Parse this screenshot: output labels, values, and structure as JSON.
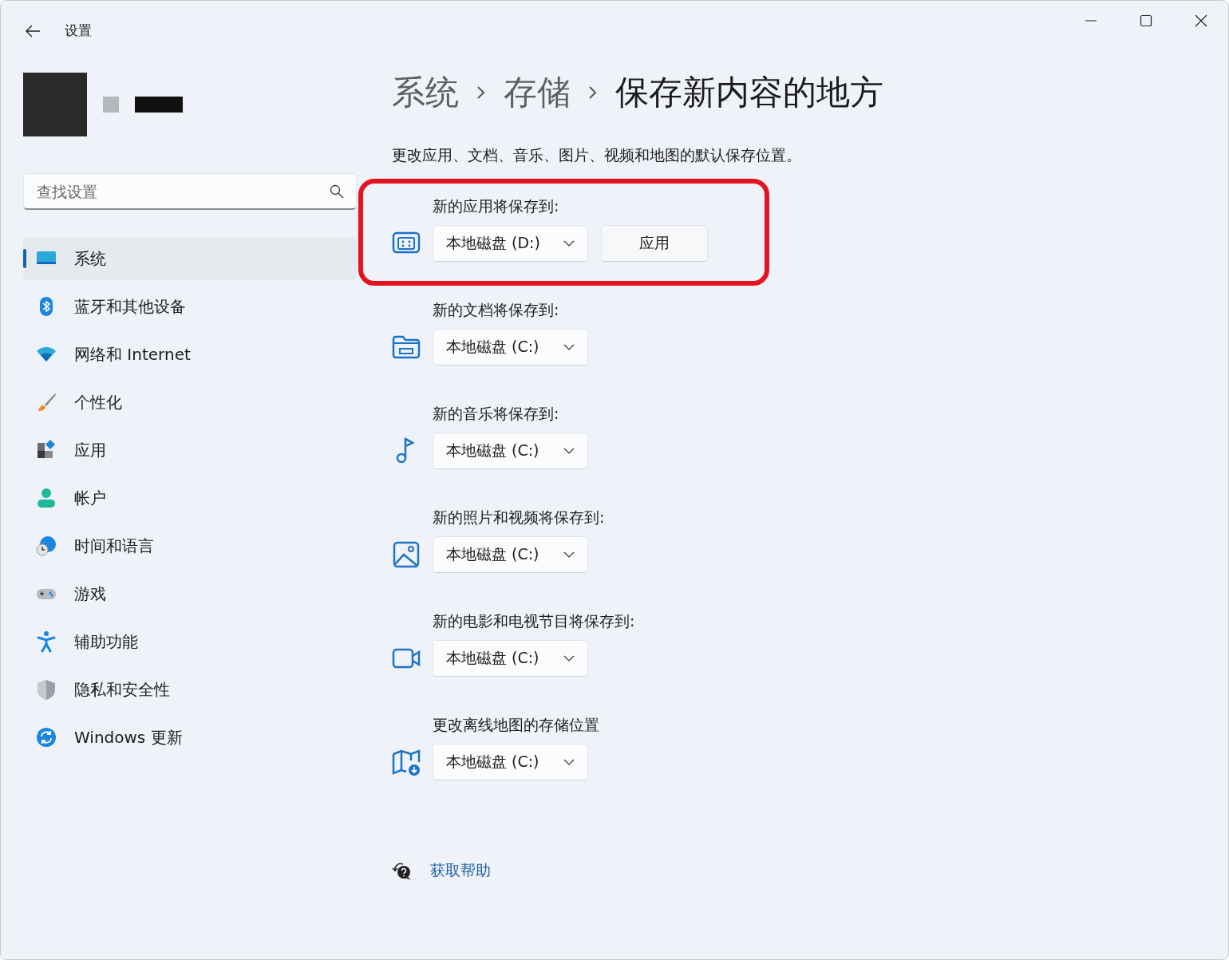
{
  "window": {
    "title": "设置"
  },
  "search": {
    "placeholder": "查找设置"
  },
  "sidebar": {
    "items": [
      {
        "label": "系统",
        "selected": true
      },
      {
        "label": "蓝牙和其他设备",
        "selected": false
      },
      {
        "label": "网络和 Internet",
        "selected": false
      },
      {
        "label": "个性化",
        "selected": false
      },
      {
        "label": "应用",
        "selected": false
      },
      {
        "label": "帐户",
        "selected": false
      },
      {
        "label": "时间和语言",
        "selected": false
      },
      {
        "label": "游戏",
        "selected": false
      },
      {
        "label": "辅助功能",
        "selected": false
      },
      {
        "label": "隐私和安全性",
        "selected": false
      },
      {
        "label": "Windows 更新",
        "selected": false
      }
    ]
  },
  "breadcrumb": [
    "系统",
    "存储",
    "保存新内容的地方"
  ],
  "description": "更改应用、文档、音乐、图片、视频和地图的默认保存位置。",
  "rows": [
    {
      "label": "新的应用将保存到:",
      "value": "本地磁盘 (D:)",
      "action": "应用",
      "highlighted": true
    },
    {
      "label": "新的文档将保存到:",
      "value": "本地磁盘 (C:)",
      "highlighted": false
    },
    {
      "label": "新的音乐将保存到:",
      "value": "本地磁盘 (C:)",
      "highlighted": false
    },
    {
      "label": "新的照片和视频将保存到:",
      "value": "本地磁盘 (C:)",
      "highlighted": false
    },
    {
      "label": "新的电影和电视节目将保存到:",
      "value": "本地磁盘 (C:)",
      "highlighted": false
    },
    {
      "label": "更改离线地图的存储位置",
      "value": "本地磁盘 (C:)",
      "highlighted": false
    }
  ],
  "help_link": "获取帮助"
}
